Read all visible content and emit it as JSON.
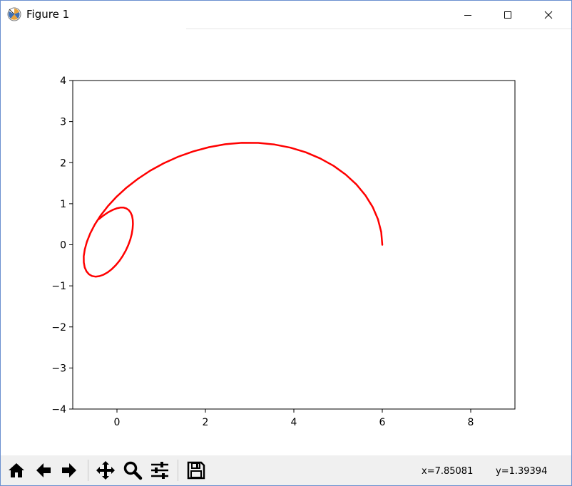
{
  "window": {
    "title": "Figure 1",
    "icons": {
      "app": "matplotlib-icon",
      "minimize": "minimize-icon",
      "maximize": "maximize-icon",
      "close": "close-icon"
    }
  },
  "toolbar": {
    "buttons": [
      {
        "name": "home-button",
        "icon": "home-icon"
      },
      {
        "name": "back-button",
        "icon": "arrow-left-icon"
      },
      {
        "name": "forward-button",
        "icon": "arrow-right-icon"
      },
      {
        "name": "pan-button",
        "icon": "move-icon"
      },
      {
        "name": "zoom-button",
        "icon": "magnifier-icon"
      },
      {
        "name": "subplots-button",
        "icon": "sliders-icon"
      },
      {
        "name": "save-button",
        "icon": "floppy-disk-icon"
      }
    ],
    "coord_x": "x=7.85081",
    "coord_y": "y=1.39394"
  },
  "chart_data": {
    "type": "line",
    "title": "",
    "xlabel": "",
    "ylabel": "",
    "xlim": [
      -1,
      9
    ],
    "ylim": [
      -4,
      4
    ],
    "xticks": [
      0,
      2,
      4,
      6,
      8
    ],
    "yticks": [
      -4,
      -3,
      -2,
      -1,
      0,
      1,
      2,
      3,
      4
    ],
    "xtick_labels": [
      "0",
      "2",
      "4",
      "6",
      "8"
    ],
    "ytick_labels": [
      "−4",
      "−3",
      "−2",
      "−1",
      "0",
      "1",
      "2",
      "3",
      "4"
    ],
    "grid": false,
    "legend": false,
    "series": [
      {
        "color": "#ff0000",
        "x": [
          6.0,
          5.975,
          5.902,
          5.782,
          5.618,
          5.414,
          5.172,
          4.898,
          4.595,
          4.269,
          3.923,
          3.563,
          3.195,
          2.822,
          2.45,
          2.083,
          1.726,
          1.383,
          1.057,
          0.752,
          0.472,
          0.218,
          -0.007,
          -0.202,
          -0.366,
          -0.5,
          -0.604,
          -0.679,
          -0.728,
          -0.751,
          -0.75,
          -0.729,
          -0.689,
          -0.633,
          -0.564,
          -0.485,
          -0.397,
          -0.305,
          -0.211,
          -0.118,
          -0.028,
          0.056,
          0.133,
          0.2,
          0.256,
          0.301,
          0.334,
          0.354,
          0.362,
          0.357,
          0.34,
          0.31,
          0.268,
          0.215,
          0.151,
          0.077,
          -0.007,
          -0.099,
          -0.198,
          -0.303,
          -0.413
        ],
        "y": [
          0.0,
          0.314,
          0.623,
          0.921,
          1.205,
          1.469,
          1.709,
          1.922,
          2.104,
          2.253,
          2.366,
          2.442,
          2.481,
          2.483,
          2.448,
          2.378,
          2.275,
          2.143,
          1.985,
          1.805,
          1.606,
          1.394,
          1.173,
          0.946,
          0.719,
          0.496,
          0.281,
          0.077,
          -0.111,
          -0.28,
          -0.428,
          -0.551,
          -0.648,
          -0.718,
          -0.76,
          -0.775,
          -0.764,
          -0.728,
          -0.671,
          -0.593,
          -0.498,
          -0.388,
          -0.268,
          -0.139,
          -0.005,
          0.129,
          0.261,
          0.388,
          0.506,
          0.613,
          0.706,
          0.783,
          0.843,
          0.884,
          0.905,
          0.906,
          0.887,
          0.848,
          0.791,
          0.715,
          0.623
        ]
      }
    ]
  }
}
